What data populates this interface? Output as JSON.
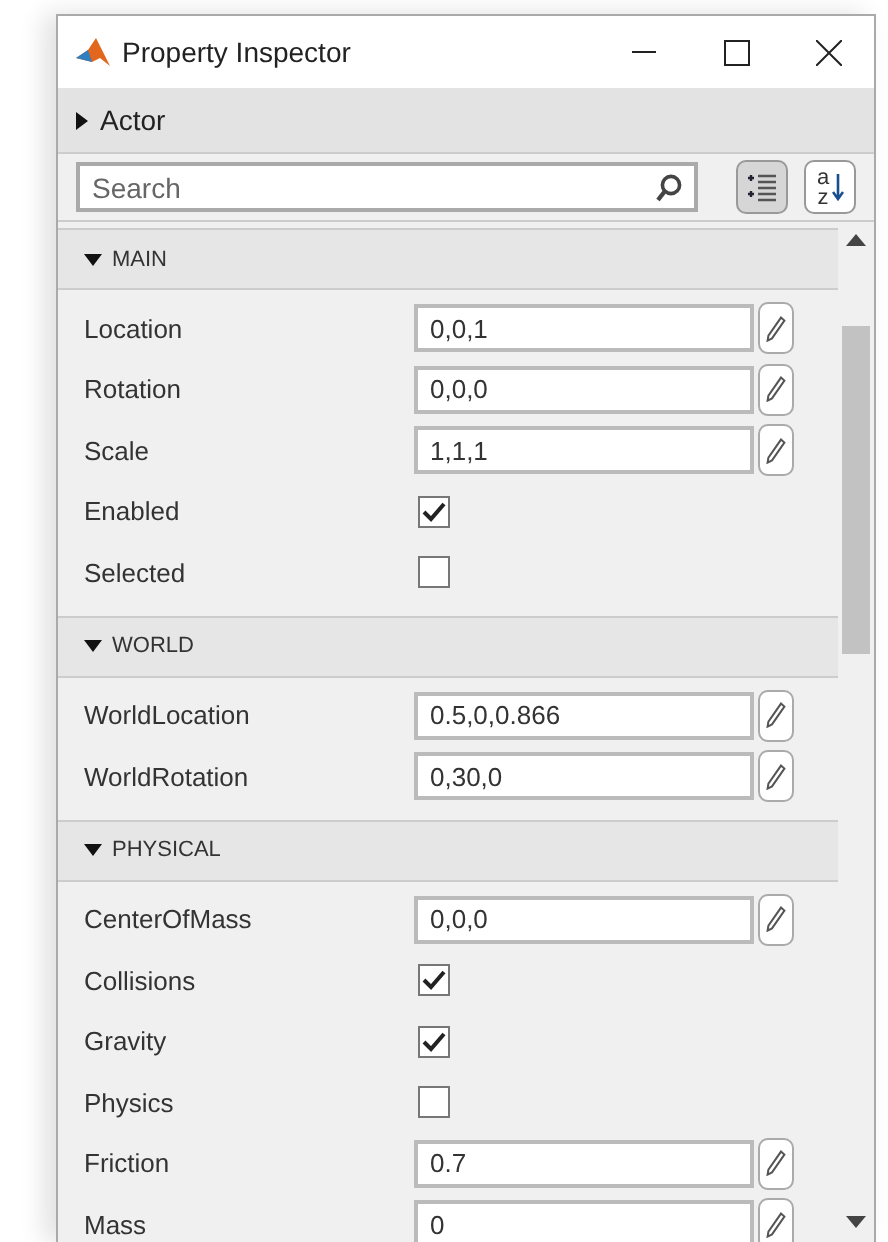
{
  "window": {
    "title": "Property Inspector"
  },
  "object_bar": {
    "label": "Actor",
    "expanded": false
  },
  "search": {
    "placeholder": "Search"
  },
  "view_buttons": [
    {
      "kind": "categorized",
      "selected": true
    },
    {
      "kind": "alphabetical",
      "selected": false,
      "letters": [
        "a",
        "z"
      ]
    }
  ],
  "sections": [
    {
      "title": "MAIN",
      "expanded": true,
      "rows": [
        {
          "kind": "text",
          "name": "Location",
          "value": "0,0,1"
        },
        {
          "kind": "text",
          "name": "Rotation",
          "value": "0,0,0"
        },
        {
          "kind": "text",
          "name": "Scale",
          "value": "1,1,1"
        },
        {
          "kind": "checkbox",
          "name": "Enabled",
          "checked": true
        },
        {
          "kind": "checkbox",
          "name": "Selected",
          "checked": false
        }
      ]
    },
    {
      "title": "WORLD",
      "expanded": true,
      "rows": [
        {
          "kind": "text",
          "name": "WorldLocation",
          "value": "0.5,0,0.866"
        },
        {
          "kind": "text",
          "name": "WorldRotation",
          "value": "0,30,0"
        }
      ]
    },
    {
      "title": "PHYSICAL",
      "expanded": true,
      "rows": [
        {
          "kind": "text",
          "name": "CenterOfMass",
          "value": "0,0,0"
        },
        {
          "kind": "checkbox",
          "name": "Collisions",
          "checked": true
        },
        {
          "kind": "checkbox",
          "name": "Gravity",
          "checked": true
        },
        {
          "kind": "checkbox",
          "name": "Physics",
          "checked": false
        },
        {
          "kind": "text",
          "name": "Friction",
          "value": "0.7"
        },
        {
          "kind": "text",
          "name": "Mass",
          "value": "0"
        }
      ]
    }
  ]
}
